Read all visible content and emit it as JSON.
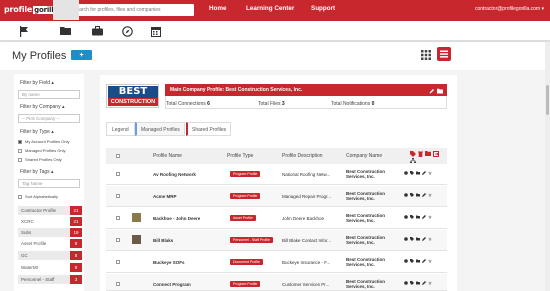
{
  "app": {
    "logo_text": "profile",
    "logo_accent": "gorilla",
    "brand_color": "#c8272e",
    "accent_blue": "#1b8fc9"
  },
  "search": {
    "placeholder": "Search for profiles, files and companies"
  },
  "nav": {
    "home": "Home",
    "learning": "Learning Center",
    "support": "Support"
  },
  "user": {
    "email": "contractor@profilegorilla.com ▾"
  },
  "toolbar_icons": [
    "flag-icon",
    "folder-icon",
    "briefcase-icon",
    "compass-icon",
    "calendar-icon"
  ],
  "page": {
    "title": "My Profiles",
    "add_label": "+"
  },
  "sidebar": {
    "filter_field_label": "Filter by Field ▴",
    "name_placeholder": "By name",
    "filter_company_label": "Filter by Company ▴",
    "company_select": "-- Pick Company --",
    "filter_type_label": "Filter by Type ▴",
    "types": [
      {
        "label": "My Account Profiles Only",
        "checked": true
      },
      {
        "label": "Managed Profiles Only",
        "checked": false
      },
      {
        "label": "Shared Profiles Only",
        "checked": false
      }
    ],
    "filter_tags_label": "Filter by Tags ▴",
    "tag_placeholder": "Tag Name",
    "sort_label": "Sort Alphabetically",
    "tags": [
      {
        "name": "Contractor Profile",
        "count": "21"
      },
      {
        "name": "XCRC",
        "count": "21"
      },
      {
        "name": "Subs",
        "count": "19"
      },
      {
        "name": "Asset Profile",
        "count": "9"
      },
      {
        "name": "GC",
        "count": "8"
      },
      {
        "name": "WaterMt",
        "count": "9"
      },
      {
        "name": "Personnel - Staff",
        "count": "3"
      }
    ]
  },
  "company": {
    "logo_top": "BEST",
    "logo_bottom": "CONSTRUCTION",
    "bar_text": "Main Company Profile: Best Construction Services, Inc.",
    "connections_label": "Total Connections",
    "connections_value": "6",
    "files_label": "Total Files",
    "files_value": "3",
    "notifications_label": "Total Notifications",
    "notifications_value": "0"
  },
  "legend": {
    "label": "Legend",
    "managed": "Managed Profiles",
    "shared": "Shared Profiles"
  },
  "table": {
    "headers": [
      "Profile Name",
      "Profile Type",
      "Profile Description",
      "Company Name"
    ],
    "rows": [
      {
        "name": "Av Roofing Network",
        "type": "Program Profile",
        "desc": "National Roofing Netw...",
        "company": "Best Construction Services, Inc."
      },
      {
        "name": "Acme MRP",
        "type": "Program Profile",
        "desc": "Managed Repair Progr...",
        "company": "Best Construction Services, Inc."
      },
      {
        "name": "Backhoe - John Deere",
        "type": "Asset Profile",
        "desc": "John Deere Backhoe",
        "company": "Best Construction Services, Inc."
      },
      {
        "name": "Bill Blaks",
        "type": "Personnel - Staff Profile",
        "desc": "Bill Blake Contact Infor...",
        "company": "Best Construction Services, Inc."
      },
      {
        "name": "Buckeye SOFs",
        "type": "Document Profile",
        "desc": "Buckeye Insurance - F...",
        "company": "Best Construction Services, Inc."
      },
      {
        "name": "Connect Program",
        "type": "Program Profile",
        "desc": "Customer Services Pr...",
        "company": "Best Construction Services, Inc."
      }
    ]
  }
}
